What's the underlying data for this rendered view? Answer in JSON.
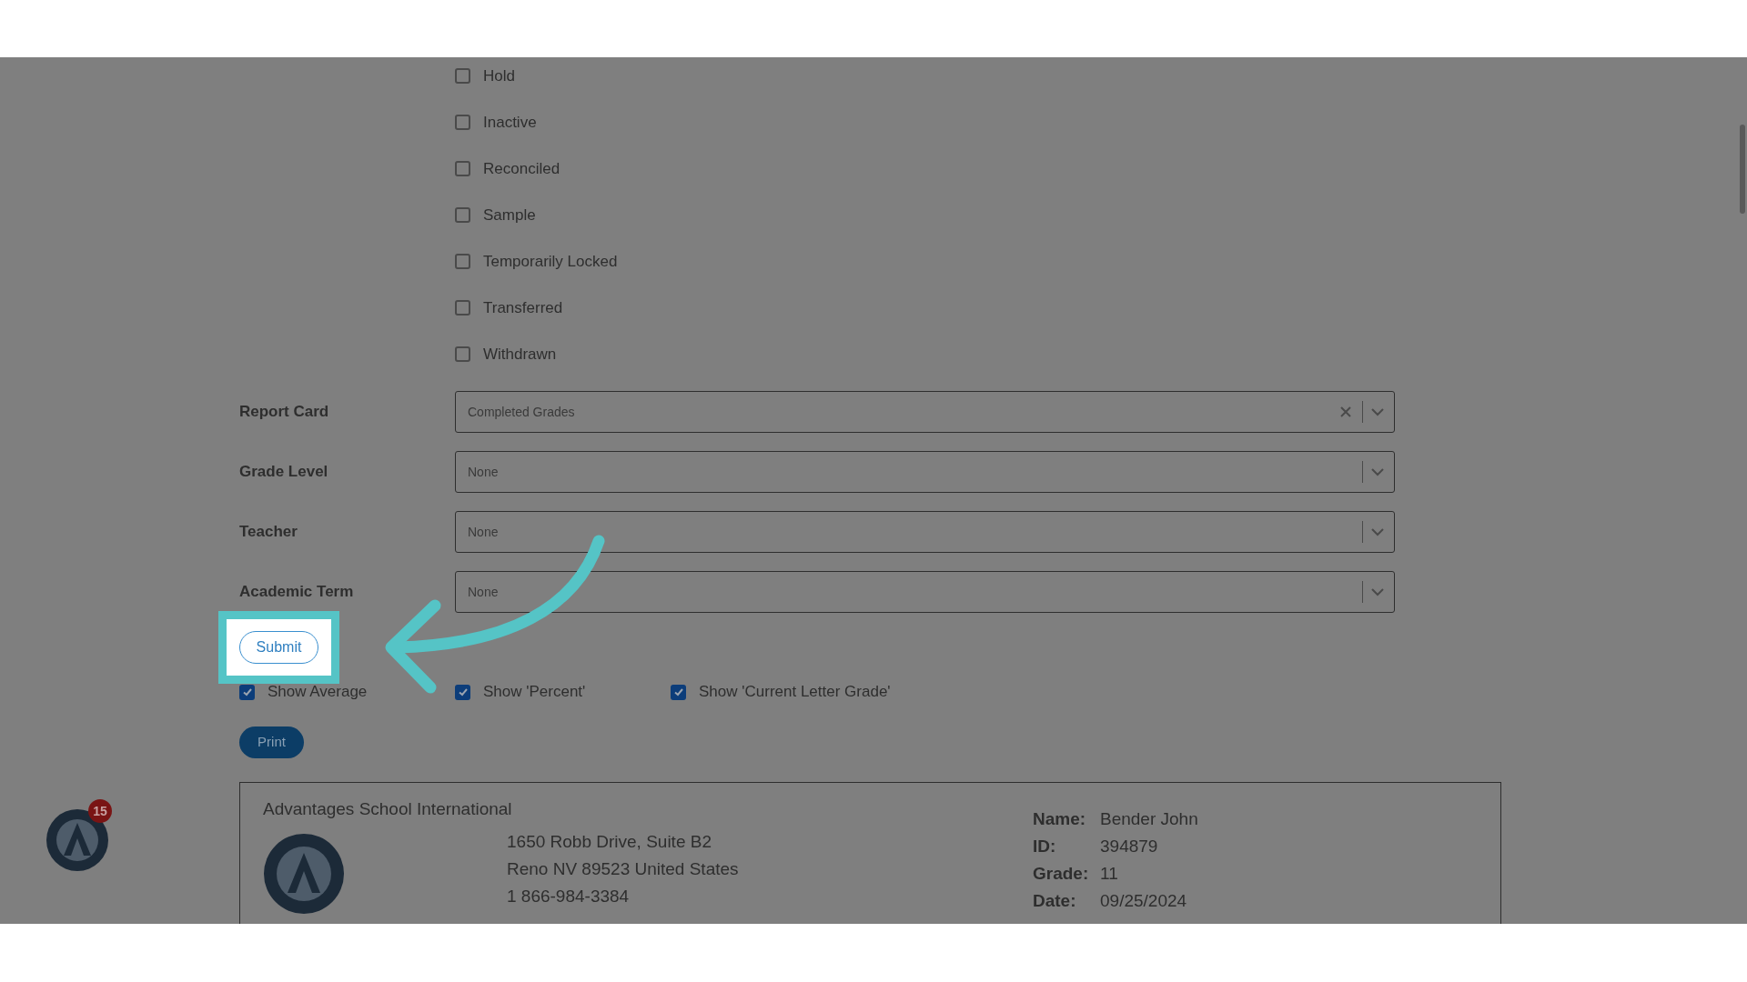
{
  "status_checkboxes": [
    {
      "label": "Hold",
      "checked": false
    },
    {
      "label": "Inactive",
      "checked": false
    },
    {
      "label": "Reconciled",
      "checked": false
    },
    {
      "label": "Sample",
      "checked": false
    },
    {
      "label": "Temporarily Locked",
      "checked": false
    },
    {
      "label": "Transferred",
      "checked": false
    },
    {
      "label": "Withdrawn",
      "checked": false
    }
  ],
  "fields": [
    {
      "label": "Report Card",
      "value": "Completed Grades",
      "clearable": true
    },
    {
      "label": "Grade Level",
      "value": "None",
      "clearable": false
    },
    {
      "label": "Teacher",
      "value": "None",
      "clearable": false
    },
    {
      "label": "Academic Term",
      "value": "None",
      "clearable": false
    }
  ],
  "submit_button": "Submit",
  "options": [
    {
      "label": "Show Average",
      "checked": true
    },
    {
      "label": "Show 'Percent'",
      "checked": true
    },
    {
      "label": "Show 'Current Letter Grade'",
      "checked": true
    }
  ],
  "print_button": "Print",
  "report": {
    "school": "Advantages School International",
    "address_lines": [
      "1650 Robb Drive, Suite B2",
      "Reno NV 89523 United States",
      "1 866-984-3384"
    ],
    "details": [
      {
        "label": "Name:",
        "value": "Bender John"
      },
      {
        "label": "ID:",
        "value": "394879"
      },
      {
        "label": "Grade:",
        "value": "11"
      },
      {
        "label": "Date:",
        "value": "09/25/2024"
      }
    ]
  },
  "notification_badge": "15"
}
